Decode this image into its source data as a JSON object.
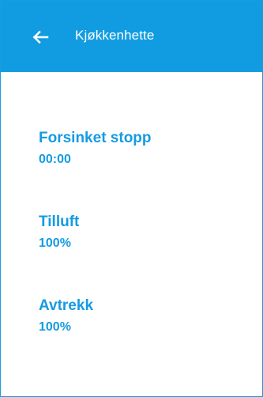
{
  "header": {
    "title": "Kjøkkenhette",
    "back_icon": "arrow-left-icon"
  },
  "settings": [
    {
      "label": "Forsinket stopp",
      "value": "00:00"
    },
    {
      "label": "Tilluft",
      "value": "100%"
    },
    {
      "label": "Avtrekk",
      "value": "100%"
    }
  ],
  "colors": {
    "header_background": "#119CE2",
    "accent_text": "#159BE2",
    "background": "#FFFFFF"
  }
}
